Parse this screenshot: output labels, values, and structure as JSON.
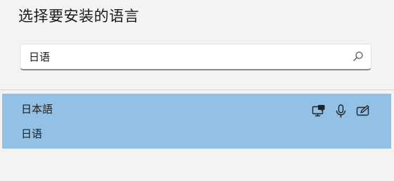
{
  "dialog": {
    "title": "选择要安装的语言"
  },
  "search": {
    "value": "日语",
    "icon": "search-icon"
  },
  "results": [
    {
      "native_name": "日本語",
      "local_name": "日语",
      "selected": true,
      "features": [
        "display-language-icon",
        "speech-icon",
        "handwriting-icon"
      ]
    }
  ],
  "colors": {
    "selected_row": "#93c1e6",
    "background": "#f3f3f3"
  }
}
